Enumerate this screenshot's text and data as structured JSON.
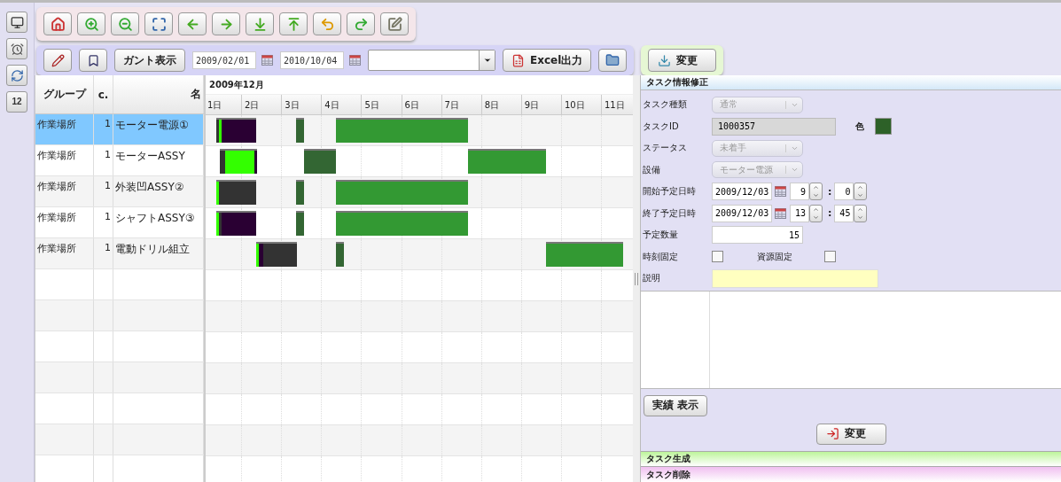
{
  "side_strip": {
    "calendar_day": "12"
  },
  "toolbar2": {
    "gantt_button": "ガント表示",
    "date_from": "2009/02/01",
    "date_to": "2010/10/04",
    "excel_button": "Excel出力"
  },
  "apply_top_button": "変更",
  "table": {
    "columns": [
      "グループ",
      "c.",
      "名"
    ],
    "rows": [
      {
        "group": "作業場所",
        "c": "1",
        "name": "モーター電源①",
        "selected": true
      },
      {
        "group": "作業場所",
        "c": "1",
        "name": "モーターASSY",
        "selected": false
      },
      {
        "group": "作業場所",
        "c": "1",
        "name": "外装凹ASSY②",
        "selected": false
      },
      {
        "group": "作業場所",
        "c": "1",
        "name": "シャフトASSY③",
        "selected": false
      },
      {
        "group": "作業場所",
        "c": "1",
        "name": "電動ドリル組立",
        "selected": false
      }
    ]
  },
  "gantt": {
    "month": "2009年12月",
    "days": [
      "1日",
      "2日",
      "3日",
      "4日",
      "5日",
      "6日",
      "7日",
      "8日",
      "9日",
      "10日",
      "11日"
    ],
    "rows": [
      {
        "segments": [
          {
            "color": "#333333"
          },
          {
            "color": "#33ff00"
          },
          {
            "color": "#2a0033"
          },
          {
            "color": "#336633"
          },
          {
            "color": "#339933"
          }
        ]
      },
      {
        "segments": [
          {
            "color": "#333333"
          },
          {
            "color": "#33ff00"
          },
          {
            "color": "#2a0033"
          },
          {
            "color": "#336633"
          },
          {
            "color": "#339933"
          }
        ]
      },
      {
        "segments": [
          {
            "color": "#33ff00"
          },
          {
            "color": "#333333"
          },
          {
            "color": "#336633"
          },
          {
            "color": "#339933"
          }
        ]
      },
      {
        "segments": [
          {
            "color": "#33ff00"
          },
          {
            "color": "#333333"
          },
          {
            "color": "#2a0033"
          },
          {
            "color": "#336633"
          },
          {
            "color": "#339933"
          }
        ]
      },
      {
        "segments": [
          {
            "color": "#33ff00"
          },
          {
            "color": "#2a0033"
          },
          {
            "color": "#333333"
          },
          {
            "color": "#336633"
          },
          {
            "color": "#339933"
          }
        ]
      }
    ]
  },
  "task_form": {
    "title": "タスク情報修正",
    "fields": [
      {
        "kind": "select",
        "label": "タスク種類",
        "value": "通常",
        "disabled": true
      },
      {
        "kind": "id",
        "label": "タスクID",
        "value": "1000357",
        "color_label": "色",
        "color": "#2d6128"
      },
      {
        "kind": "select",
        "label": "ステータス",
        "value": "未着手",
        "disabled": true
      },
      {
        "kind": "select",
        "label": "設備",
        "value": "モーター電源",
        "disabled": true
      },
      {
        "kind": "datetime",
        "label": "開始予定日時",
        "date": "2009/12/03",
        "hour": "9",
        "separator": ":",
        "minute": "0"
      },
      {
        "kind": "datetime",
        "label": "終了予定日時",
        "date": "2009/12/03",
        "hour": "13",
        "separator": ":",
        "minute": "45"
      },
      {
        "kind": "number",
        "label": "予定数量",
        "value": "15"
      },
      {
        "kind": "checks",
        "label": "時刻固定",
        "checked": false,
        "second_label": "資源固定",
        "second_checked": false
      },
      {
        "kind": "memo",
        "label": "説明"
      }
    ],
    "result_button": "実績 表示",
    "apply_button": "変更"
  },
  "sections": [
    {
      "title": "タスク生成",
      "color": "#bdf59a"
    },
    {
      "title": "タスク削除",
      "color": "#f0bff0"
    }
  ]
}
